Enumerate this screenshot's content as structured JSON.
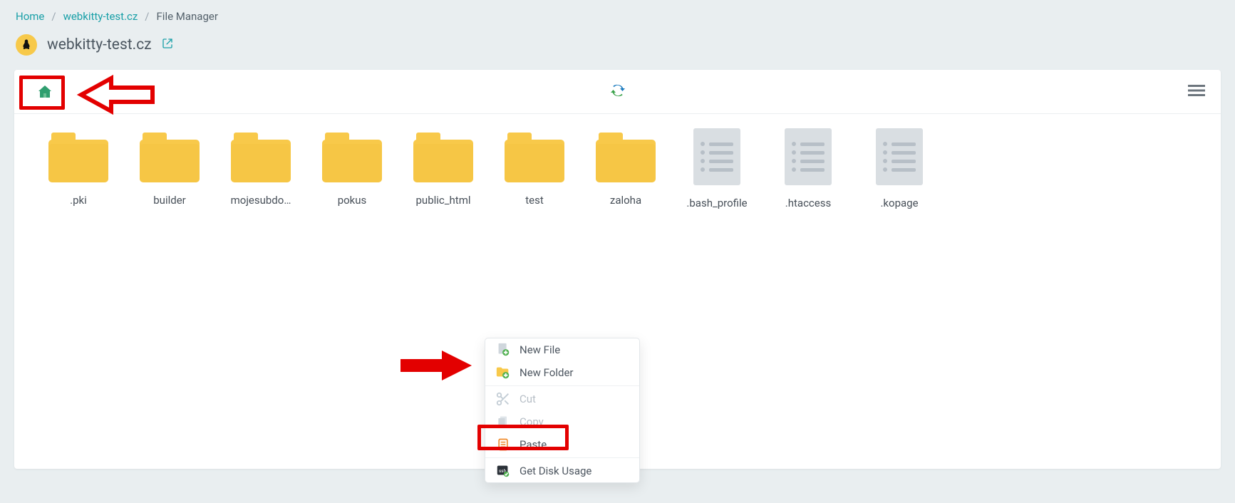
{
  "breadcrumb": {
    "home": "Home",
    "domain": "webkitty-test.cz",
    "page": "File Manager"
  },
  "title": {
    "domain": "webkitty-test.cz"
  },
  "items": [
    {
      "type": "folder",
      "name": ".pki"
    },
    {
      "type": "folder",
      "name": "builder"
    },
    {
      "type": "folder",
      "name": "mojesubdo…"
    },
    {
      "type": "folder",
      "name": "pokus"
    },
    {
      "type": "folder",
      "name": "public_html"
    },
    {
      "type": "folder",
      "name": "test"
    },
    {
      "type": "folder",
      "name": "zaloha"
    },
    {
      "type": "file",
      "name": ".bash_profile"
    },
    {
      "type": "file",
      "name": ".htaccess"
    },
    {
      "type": "file",
      "name": ".kopage"
    }
  ],
  "context_menu": {
    "new_file": "New File",
    "new_folder": "New Folder",
    "cut": "Cut",
    "copy": "Copy",
    "paste": "Paste",
    "disk_usage": "Get Disk Usage"
  }
}
